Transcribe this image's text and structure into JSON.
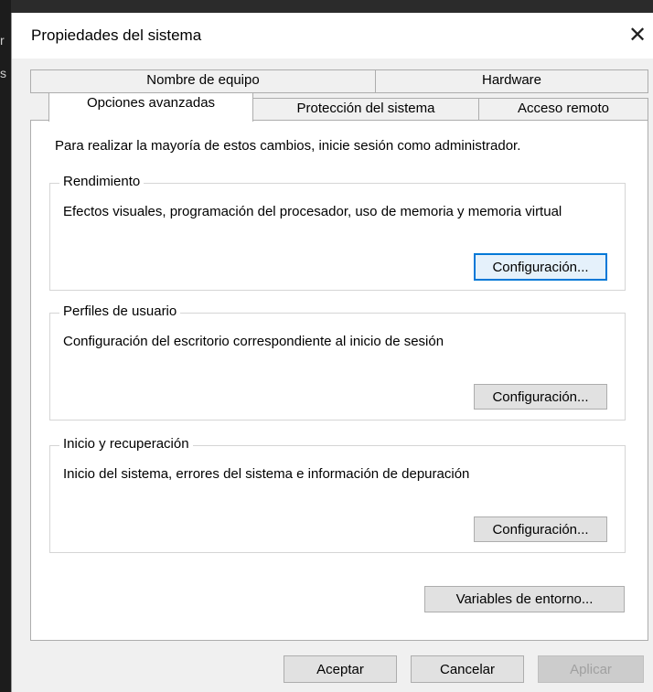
{
  "window": {
    "title": "Propiedades del sistema"
  },
  "background": {
    "glyph_1": "r",
    "glyph_2": "s"
  },
  "tabs": {
    "row_back": [
      {
        "label": "Nombre de equipo"
      },
      {
        "label": "Hardware"
      }
    ],
    "row_front": [
      {
        "label": "Opciones avanzadas",
        "active": true
      },
      {
        "label": "Protección del sistema"
      },
      {
        "label": "Acceso remoto"
      }
    ]
  },
  "panel": {
    "intro": "Para realizar la mayoría de estos cambios, inicie sesión como administrador.",
    "groups": [
      {
        "title": "Rendimiento",
        "desc": "Efectos visuales, programación del procesador, uso de memoria y memoria virtual",
        "button": "Configuración..."
      },
      {
        "title": "Perfiles de usuario",
        "desc": "Configuración del escritorio correspondiente al inicio de sesión",
        "button": "Configuración..."
      },
      {
        "title": "Inicio y recuperación",
        "desc": "Inicio del sistema, errores del sistema e información de depuración",
        "button": "Configuración..."
      }
    ],
    "env_button": "Variables de entorno..."
  },
  "footer": {
    "ok": "Aceptar",
    "cancel": "Cancelar",
    "apply": "Aplicar"
  }
}
